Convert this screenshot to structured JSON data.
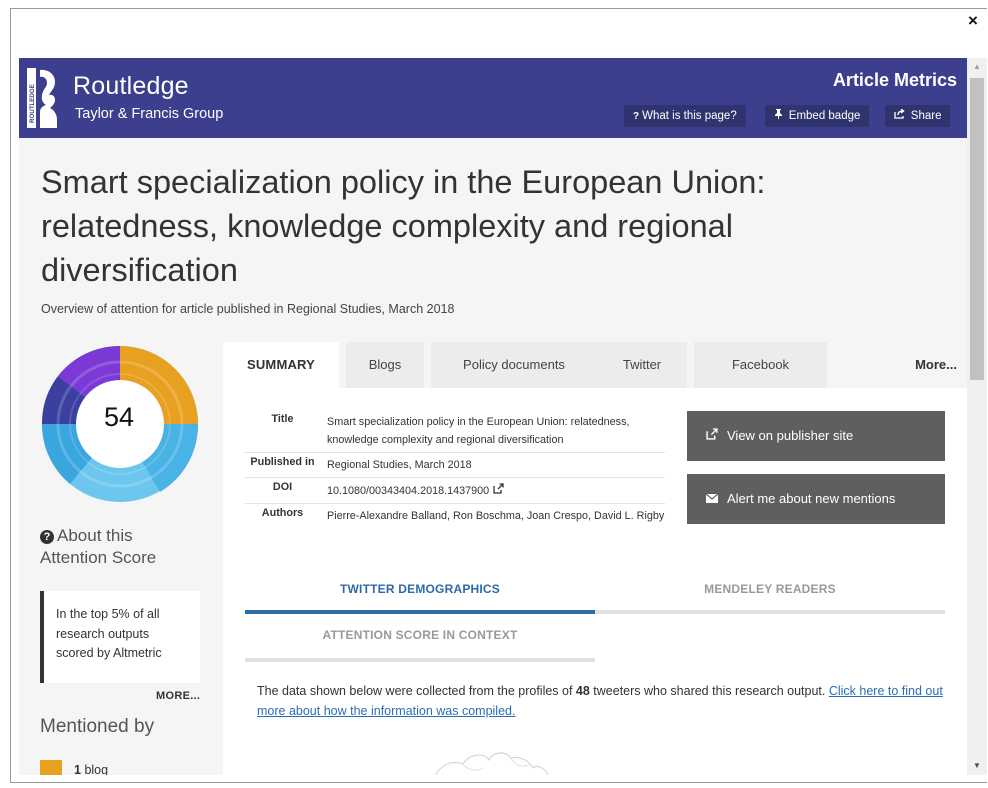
{
  "dialog": {
    "close_glyph": "×"
  },
  "header": {
    "brand_name": "Routledge",
    "brand_sub": "Taylor & Francis Group",
    "logo_vertical_text": "ROUTLEDGE",
    "section_title": "Article Metrics",
    "buttons": [
      {
        "icon": "?",
        "label": "What is this page?"
      },
      {
        "icon": "⯈",
        "label": "Embed badge"
      },
      {
        "icon": "↗",
        "label": "Share"
      }
    ],
    "colors": {
      "banner": "#3b3f8d",
      "button": "#2f346f"
    }
  },
  "article": {
    "title": "Smart specialization policy in the European Union: relatedness, knowledge complexity and regional diversification",
    "overview": "Overview of attention for article published in Regional Studies, March 2018"
  },
  "score": {
    "value": "54",
    "about_label": "About this Attention Score",
    "context_text": "In the top 5% of all research outputs scored by Altmetric",
    "more_label": "MORE...",
    "donut_colors": [
      "#3a3fa0",
      "#7b3ad6",
      "#e8a020",
      "#3aa6de",
      "#6cc6ee"
    ]
  },
  "mentioned_by": {
    "heading": "Mentioned by",
    "items": [
      {
        "count": "1",
        "label": "blog",
        "color": "#e8a020"
      }
    ]
  },
  "tabs": {
    "items": [
      "SUMMARY",
      "Blogs",
      "Policy documents",
      "Twitter",
      "Facebook"
    ],
    "active": "SUMMARY",
    "more_label": "More..."
  },
  "details": {
    "title_key": "Title",
    "title_value": "Smart specialization policy in the European Union: relatedness, knowledge complexity and regional diversification",
    "published_key": "Published in",
    "published_value": "Regional Studies, March 2018",
    "doi_key": "DOI",
    "doi_value": "10.1080/00343404.2018.1437900",
    "authors_key": "Authors",
    "authors_value": "Pierre-Alexandre Balland, Ron Boschma, Joan Crespo, David L. Rigby"
  },
  "actions": {
    "publisher_label": "View on publisher site",
    "alert_label": "Alert me about new mentions"
  },
  "demographics": {
    "tab_twitter": "TWITTER DEMOGRAPHICS",
    "tab_mendeley": "MENDELEY READERS",
    "tab_context": "ATTENTION SCORE IN CONTEXT",
    "desc_prefix": "The data shown below were collected from the profiles of ",
    "tweeter_count": "48",
    "desc_suffix": " tweeters who shared this research output. ",
    "desc_link": "Click here to find out more about how the information was compiled."
  },
  "scrollbar": {
    "up_glyph": "▲",
    "down_glyph": "▼"
  }
}
